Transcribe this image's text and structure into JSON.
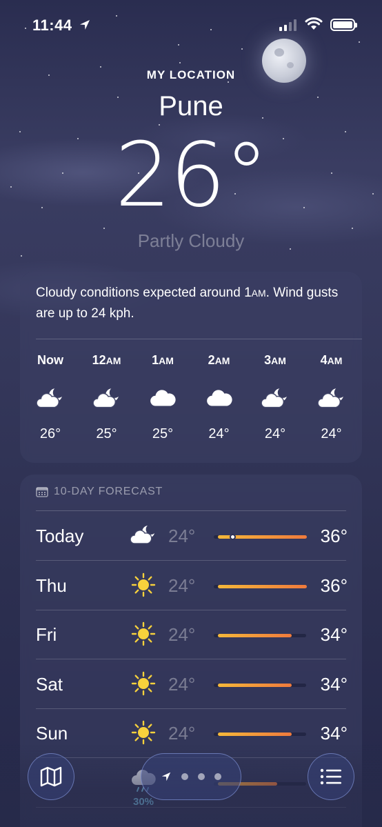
{
  "status_bar": {
    "time": "11:44",
    "location_icon": "location-arrow-icon",
    "signal_icon": "cellular-signal-icon",
    "wifi_icon": "wifi-icon",
    "battery_icon": "battery-icon"
  },
  "header": {
    "location_label": "MY LOCATION",
    "city": "Pune",
    "temperature": "26°",
    "condition": "Partly Cloudy"
  },
  "hourly": {
    "summary_part1": "Cloudy conditions expected around 1",
    "summary_am": "AM",
    "summary_part2": ". Wind gusts are up to 24 kph.",
    "hours": [
      {
        "label": "Now",
        "suffix": "",
        "icon": "partly-cloudy-night-icon",
        "temp": "26°"
      },
      {
        "label": "12",
        "suffix": "AM",
        "icon": "partly-cloudy-night-icon",
        "temp": "25°"
      },
      {
        "label": "1",
        "suffix": "AM",
        "icon": "cloud-icon",
        "temp": "25°"
      },
      {
        "label": "2",
        "suffix": "AM",
        "icon": "cloud-icon",
        "temp": "24°"
      },
      {
        "label": "3",
        "suffix": "AM",
        "icon": "partly-cloudy-night-icon",
        "temp": "24°"
      },
      {
        "label": "4",
        "suffix": "AM",
        "icon": "partly-cloudy-night-icon",
        "temp": "24°"
      }
    ]
  },
  "forecast": {
    "title": "10-DAY FORECAST",
    "calendar_icon": "calendar-icon",
    "range_min": 24,
    "range_max": 36,
    "current_temp": 26,
    "days": [
      {
        "day": "Today",
        "icon": "partly-cloudy-night-icon",
        "low": "24°",
        "high": "36°",
        "low_val": 24,
        "high_val": 36
      },
      {
        "day": "Thu",
        "icon": "sun-icon",
        "low": "24°",
        "high": "36°",
        "low_val": 24,
        "high_val": 36
      },
      {
        "day": "Fri",
        "icon": "sun-icon",
        "low": "24°",
        "high": "34°",
        "low_val": 24,
        "high_val": 34
      },
      {
        "day": "Sat",
        "icon": "sun-icon",
        "low": "24°",
        "high": "34°",
        "low_val": 24,
        "high_val": 34
      },
      {
        "day": "Sun",
        "icon": "sun-icon",
        "low": "24°",
        "high": "34°",
        "low_val": 24,
        "high_val": 34
      },
      {
        "day": "",
        "icon": "rain-cloud-icon",
        "rain": "30%",
        "low": "",
        "high": "",
        "low_val": 24,
        "high_val": 32
      }
    ]
  },
  "toolbar": {
    "map_icon": "map-icon",
    "list_icon": "list-icon",
    "pager_location_icon": "location-arrow-icon",
    "page_count": 3
  },
  "colors": {
    "bar_start": "#f5b83a",
    "bar_end": "#ef7a3c",
    "rain": "#7fd0f5"
  }
}
